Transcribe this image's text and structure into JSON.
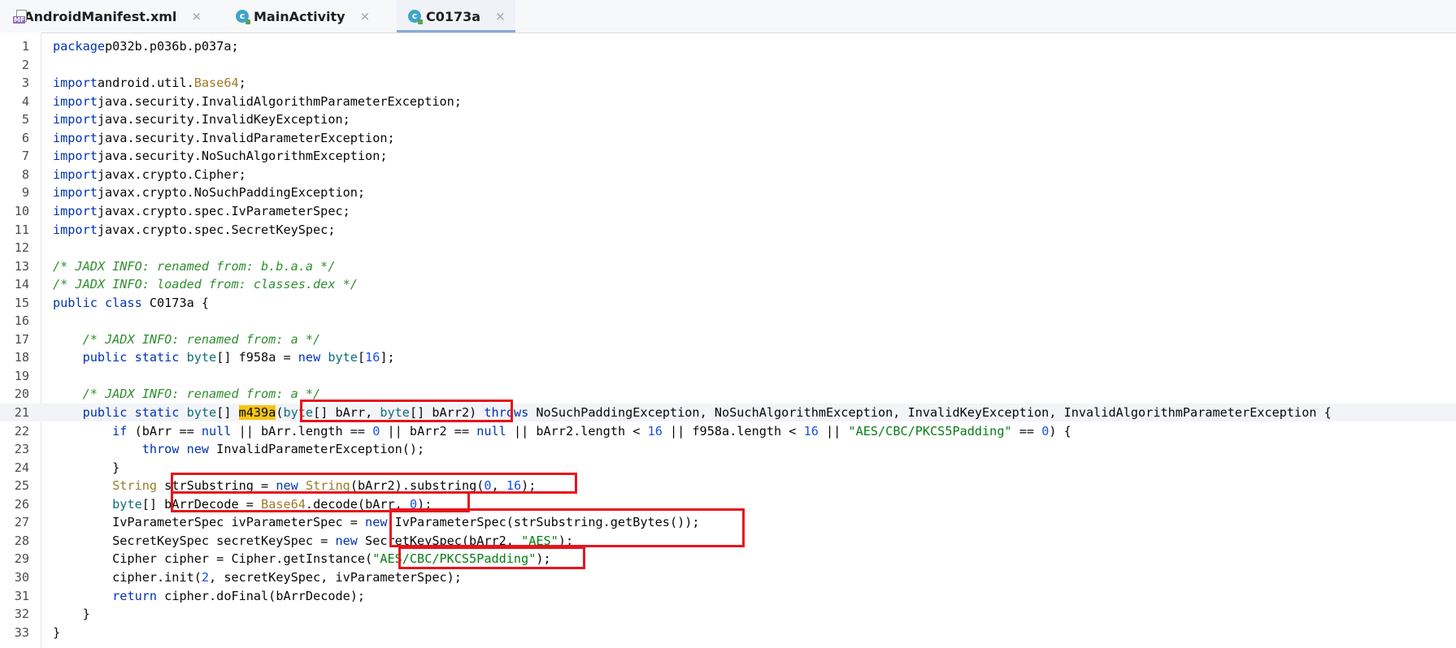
{
  "tabs": [
    {
      "label": "AndroidManifest.xml",
      "icon": "manifest-file-icon"
    },
    {
      "label": "MainActivity",
      "icon": "class-icon"
    },
    {
      "label": "C0173a",
      "icon": "class-icon",
      "active": true
    }
  ],
  "close_glyph": "×",
  "class_icon_glyph": "c",
  "manifest_icon_label": "MF",
  "lines": [
    {
      "n": "1",
      "tokens": [
        [
          "kw",
          "package"
        ],
        [
          "",
          "p032b.p036b.p037a;"
        ]
      ]
    },
    {
      "n": "2",
      "tokens": []
    },
    {
      "n": "3",
      "tokens": [
        [
          "kw",
          "import"
        ],
        [
          "",
          "android.util."
        ],
        [
          "cls-lib",
          "Base64"
        ],
        [
          "",
          ";"
        ]
      ]
    },
    {
      "n": "4",
      "tokens": [
        [
          "kw",
          "import"
        ],
        [
          "",
          "java.security.InvalidAlgorithmParameterException;"
        ]
      ]
    },
    {
      "n": "5",
      "tokens": [
        [
          "kw",
          "import"
        ],
        [
          "",
          "java.security.InvalidKeyException;"
        ]
      ]
    },
    {
      "n": "6",
      "tokens": [
        [
          "kw",
          "import"
        ],
        [
          "",
          "java.security.InvalidParameterException;"
        ]
      ]
    },
    {
      "n": "7",
      "tokens": [
        [
          "kw",
          "import"
        ],
        [
          "",
          "java.security.NoSuchAlgorithmException;"
        ]
      ]
    },
    {
      "n": "8",
      "tokens": [
        [
          "kw",
          "import"
        ],
        [
          "",
          "javax.crypto.Cipher;"
        ]
      ]
    },
    {
      "n": "9",
      "tokens": [
        [
          "kw",
          "import"
        ],
        [
          "",
          "javax.crypto.NoSuchPaddingException;"
        ]
      ]
    },
    {
      "n": "10",
      "tokens": [
        [
          "kw",
          "import"
        ],
        [
          "",
          "javax.crypto.spec.IvParameterSpec;"
        ]
      ]
    },
    {
      "n": "11",
      "tokens": [
        [
          "kw",
          "import"
        ],
        [
          "",
          "javax.crypto.spec.SecretKeySpec;"
        ]
      ]
    },
    {
      "n": "12",
      "tokens": []
    },
    {
      "n": "13",
      "tokens": [
        [
          "cmt",
          "/* JADX INFO: renamed from: b.b.a.a */"
        ]
      ]
    },
    {
      "n": "14",
      "tokens": [
        [
          "cmt",
          "/* JADX INFO: loaded from: classes.dex */"
        ]
      ]
    },
    {
      "n": "15",
      "tokens": [
        [
          "kw",
          "public class"
        ],
        [
          "",
          " C0173a {"
        ]
      ]
    },
    {
      "n": "16",
      "tokens": []
    },
    {
      "n": "17",
      "tokens": [
        [
          "",
          "    "
        ],
        [
          "cmt",
          "/* JADX INFO: renamed from: a */"
        ]
      ]
    },
    {
      "n": "18",
      "tokens": [
        [
          "",
          "    "
        ],
        [
          "kw",
          "public static"
        ],
        [
          "",
          " "
        ],
        [
          "type",
          "byte"
        ],
        [
          "",
          "[] f958a = "
        ],
        [
          "kw",
          "new"
        ],
        [
          "",
          " "
        ],
        [
          "type",
          "byte"
        ],
        [
          "",
          "["
        ],
        [
          "num",
          "16"
        ],
        [
          "",
          "];"
        ]
      ]
    },
    {
      "n": "19",
      "tokens": []
    },
    {
      "n": "20",
      "tokens": [
        [
          "",
          "    "
        ],
        [
          "cmt",
          "/* JADX INFO: renamed from: a */"
        ]
      ]
    },
    {
      "n": "21",
      "current": true,
      "tokens": [
        [
          "",
          "    "
        ],
        [
          "kw",
          "public static"
        ],
        [
          "",
          " "
        ],
        [
          "type",
          "byte"
        ],
        [
          "",
          "[] "
        ],
        [
          "hl",
          "m439a"
        ],
        [
          "",
          "("
        ],
        [
          "type",
          "byte"
        ],
        [
          "",
          "[] bArr, "
        ],
        [
          "type",
          "byte"
        ],
        [
          "",
          "[] bArr2) "
        ],
        [
          "kw",
          "throws"
        ],
        [
          "",
          " NoSuchPaddingException, NoSuchAlgorithmException, InvalidKeyException, InvalidAlgorithmParameterException {"
        ]
      ]
    },
    {
      "n": "22",
      "tokens": [
        [
          "",
          "        "
        ],
        [
          "kw",
          "if"
        ],
        [
          "",
          " (bArr == "
        ],
        [
          "kw",
          "null"
        ],
        [
          "",
          " || bArr.length == "
        ],
        [
          "num",
          "0"
        ],
        [
          "",
          " || bArr2 == "
        ],
        [
          "kw",
          "null"
        ],
        [
          "",
          " || bArr2.length < "
        ],
        [
          "num",
          "16"
        ],
        [
          "",
          " || f958a.length < "
        ],
        [
          "num",
          "16"
        ],
        [
          "",
          " || "
        ],
        [
          "str",
          "\"AES/CBC/PKCS5Padding\""
        ],
        [
          "",
          " == "
        ],
        [
          "num",
          "0"
        ],
        [
          "",
          ") {"
        ]
      ]
    },
    {
      "n": "23",
      "tokens": [
        [
          "",
          "            "
        ],
        [
          "kw",
          "throw new"
        ],
        [
          "",
          " InvalidParameterException();"
        ]
      ]
    },
    {
      "n": "24",
      "tokens": [
        [
          "",
          "        }"
        ]
      ]
    },
    {
      "n": "25",
      "tokens": [
        [
          "",
          "        "
        ],
        [
          "cls-lib",
          "String"
        ],
        [
          "",
          " strSubstring = "
        ],
        [
          "kw",
          "new"
        ],
        [
          "",
          " "
        ],
        [
          "cls-lib",
          "String"
        ],
        [
          "",
          "(bArr2).substring("
        ],
        [
          "num",
          "0"
        ],
        [
          "",
          ", "
        ],
        [
          "num",
          "16"
        ],
        [
          "",
          ");"
        ]
      ]
    },
    {
      "n": "26",
      "tokens": [
        [
          "",
          "        "
        ],
        [
          "type",
          "byte"
        ],
        [
          "",
          "[] bArrDecode = "
        ],
        [
          "cls-lib",
          "Base64"
        ],
        [
          "",
          ".decode(bArr, "
        ],
        [
          "num",
          "0"
        ],
        [
          "",
          ");"
        ]
      ]
    },
    {
      "n": "27",
      "tokens": [
        [
          "",
          "        IvParameterSpec ivParameterSpec = "
        ],
        [
          "kw",
          "new"
        ],
        [
          "",
          " IvParameterSpec(strSubstring.getBytes());"
        ]
      ]
    },
    {
      "n": "28",
      "tokens": [
        [
          "",
          "        SecretKeySpec secretKeySpec = "
        ],
        [
          "kw",
          "new"
        ],
        [
          "",
          " SecretKeySpec(bArr2, "
        ],
        [
          "str",
          "\"AES\""
        ],
        [
          "",
          ");"
        ]
      ]
    },
    {
      "n": "29",
      "tokens": [
        [
          "",
          "        Cipher cipher = Cipher.getInstance("
        ],
        [
          "str",
          "\"AES/CBC/PKCS5Padding\""
        ],
        [
          "",
          ");"
        ]
      ]
    },
    {
      "n": "30",
      "tokens": [
        [
          "",
          "        cipher.init("
        ],
        [
          "num",
          "2"
        ],
        [
          "",
          ", secretKeySpec, ivParameterSpec);"
        ]
      ]
    },
    {
      "n": "31",
      "tokens": [
        [
          "",
          "        "
        ],
        [
          "kw",
          "return"
        ],
        [
          "",
          " cipher.doFinal(bArrDecode);"
        ]
      ]
    },
    {
      "n": "32",
      "tokens": [
        [
          "",
          "    }"
        ]
      ]
    },
    {
      "n": "33",
      "tokens": [
        [
          "",
          "}"
        ]
      ]
    }
  ]
}
